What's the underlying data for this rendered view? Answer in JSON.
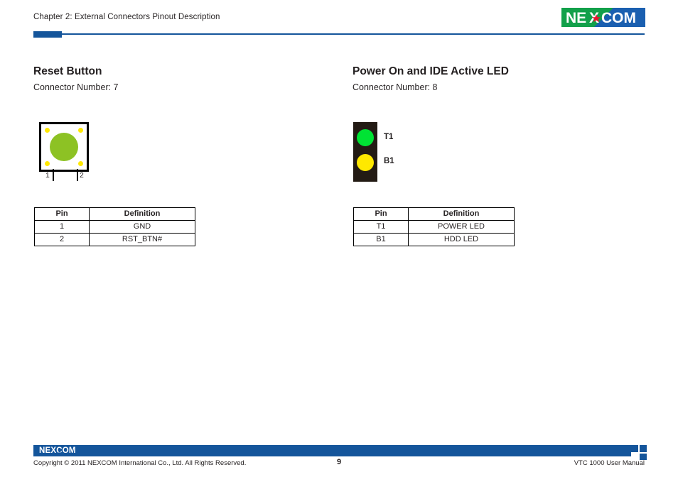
{
  "header": {
    "chapter_text": "Chapter 2: External Connectors Pinout Description",
    "logo": {
      "left_text": "NE",
      "mark": "X",
      "right_text": "COM",
      "green": "#12a04a",
      "blue": "#1a5fb0",
      "star_color": "#e8112d"
    },
    "rule_color": "#14559b"
  },
  "sections": [
    {
      "title": "Reset Button",
      "subtitle": "Connector Number: 7",
      "diagram": {
        "type": "reset-button",
        "corner_dot_color": "#ffe800",
        "center_circle_color": "#8dc224",
        "outline_color": "#000000",
        "pin_labels": [
          "1",
          "2"
        ]
      },
      "table": {
        "headers": [
          "Pin",
          "Definition"
        ],
        "rows": [
          [
            "1",
            "GND"
          ],
          [
            "2",
            "RST_BTN#"
          ]
        ]
      }
    },
    {
      "title": "Power On and IDE Active LED",
      "subtitle": "Connector Number: 8",
      "diagram": {
        "type": "led-pair",
        "body_color": "#231b14",
        "leds": [
          {
            "label": "T1",
            "color": "#00e334"
          },
          {
            "label": "B1",
            "color": "#ffe800"
          }
        ]
      },
      "table": {
        "headers": [
          "Pin",
          "Definition"
        ],
        "rows": [
          [
            "T1",
            "POWER LED"
          ],
          [
            "B1",
            "HDD LED"
          ]
        ]
      }
    }
  ],
  "footer": {
    "logo_text": "NEXCOM",
    "copyright": "Copyright © 2011 NEXCOM International Co., Ltd. All Rights Reserved.",
    "page_number": "9",
    "manual_title": "VTC 1000 User Manual",
    "bar_color": "#14559b"
  }
}
